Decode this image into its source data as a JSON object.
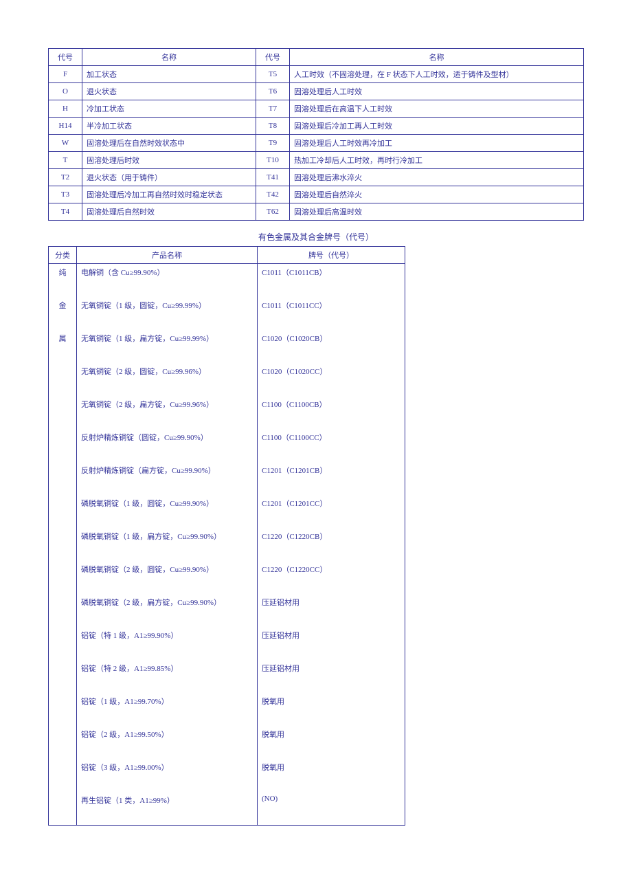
{
  "table1": {
    "headers": [
      "代号",
      "名称",
      "代号",
      "名称"
    ],
    "rows": [
      [
        "F",
        "加工状态",
        "T5",
        "人工时效（不固溶处理，在 F 状态下人工时效，适于铸件及型材）"
      ],
      [
        "O",
        "退火状态",
        "T6",
        "固溶处理后人工时效"
      ],
      [
        "H",
        "冷加工状态",
        "T7",
        "固溶处理后在高温下人工时效"
      ],
      [
        "H14",
        "半冷加工状态",
        "T8",
        "固溶处理后冷加工再人工时效"
      ],
      [
        "W",
        "固溶处理后在自然时效状态中",
        "T9",
        "固溶处理后人工时效再冷加工"
      ],
      [
        "T",
        "固溶处理后时效",
        "T10",
        "热加工冷却后人工时效，再时行冷加工"
      ],
      [
        "T2",
        "退火状态（用于铸件）",
        "T41",
        "固溶处理后沸水淬火"
      ],
      [
        "T3",
        "固溶处理后冷加工再自然时效时稳定状态",
        "T42",
        "固溶处理后自然淬火"
      ],
      [
        "T4",
        "固溶处理后自然时效",
        "T62",
        "固溶处理后高温时效"
      ]
    ]
  },
  "title2": "有色金属及其合金牌号（代号）",
  "table2": {
    "headers": [
      "分类",
      "产品名称",
      "牌号（代号）"
    ],
    "rows": [
      [
        "纯",
        "电解铜（含 Cu≥99.90%）",
        "C1011（C1011CB）"
      ],
      [
        "金",
        "无氧铜锭（1 级，圆锭，Cu≥99.99%）",
        "C1011（C1011CC）"
      ],
      [
        "属",
        "无氧铜锭（1 级，扁方锭，Cu≥99.99%）",
        "C1020（C1020CB）"
      ],
      [
        "",
        "无氧铜锭（2 级，圆锭，Cu≥99.96%）",
        "C1020（C1020CC）"
      ],
      [
        "",
        "无氧铜锭（2 级，扁方锭，Cu≥99.96%）",
        "C1100（C1100CB）"
      ],
      [
        "",
        "反射炉精炼铜锭（圆锭，Cu≥99.90%）",
        "C1100（C1100CC）"
      ],
      [
        "",
        "反射炉精炼铜锭（扁方锭，Cu≥99.90%）",
        "C1201（C1201CB）"
      ],
      [
        "",
        "磷脱氧铜锭（1 级，圆锭，Cu≥99.90%）",
        "C1201（C1201CC）"
      ],
      [
        "",
        "磷脱氧铜锭（1 级，扁方锭，Cu≥99.90%）",
        "C1220（C1220CB）"
      ],
      [
        "",
        "磷脱氧铜锭（2 级，圆锭，Cu≥99.90%）",
        "C1220（C1220CC）"
      ],
      [
        "",
        "磷脱氧铜锭（2 级，扁方锭，Cu≥99.90%）",
        "压延铝材用"
      ],
      [
        "",
        "铝锭（特 1 级，A1≥99.90%）",
        "压延铝材用"
      ],
      [
        "",
        "铝锭（特 2 级，A1≥99.85%）",
        "压延铝材用"
      ],
      [
        "",
        "铝锭（1 级，A1≥99.70%）",
        "脱氧用"
      ],
      [
        "",
        "铝锭（2 级，A1≥99.50%）",
        "脱氧用"
      ],
      [
        "",
        "铝锭（3 级，A1≥99.00%）",
        "脱氧用"
      ],
      [
        "",
        "再生铝锭（1 类，A1≥99%）",
        "(NO)"
      ]
    ]
  }
}
